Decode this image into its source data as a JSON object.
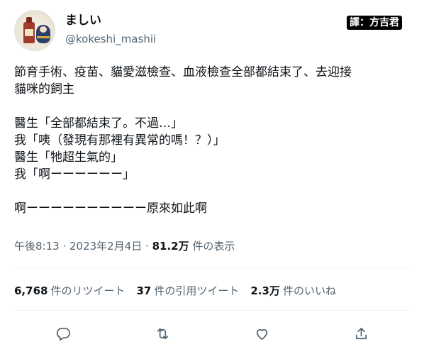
{
  "author": {
    "display_name": "ましい",
    "handle": "@kokeshi_mashii"
  },
  "translator_badge": "譯：方吉君",
  "tweet": {
    "lines": [
      "節育手術、疫苗、貓愛滋檢查、血液檢查全部都結束了、去迎接",
      "貓咪的飼主",
      "",
      "醫生「全部都結束了。不過…」",
      "我「咦（發現有那裡有異常的嗎！？）」",
      "醫生「牠超生氣的」",
      "我「啊ーーーーーー」",
      "",
      "啊ーーーーーーーーーー原來如此啊"
    ]
  },
  "meta": {
    "time_date": "午後8:13 · 2023年2月4日 · ",
    "views_count": "81.2万",
    "views_label": " 件の表示"
  },
  "stats": {
    "retweets_count": "6,768",
    "retweets_label": "件のリツイート",
    "quotes_count": "37",
    "quotes_label": "件の引用ツイート",
    "likes_count": "2.3万",
    "likes_label": "件のいいね"
  },
  "actions": {
    "icons": [
      "reply-icon",
      "retweet-icon",
      "like-icon",
      "share-icon"
    ]
  },
  "colors": {
    "text": "#0f1419",
    "secondary": "#536471",
    "divider": "#eff3f4"
  }
}
